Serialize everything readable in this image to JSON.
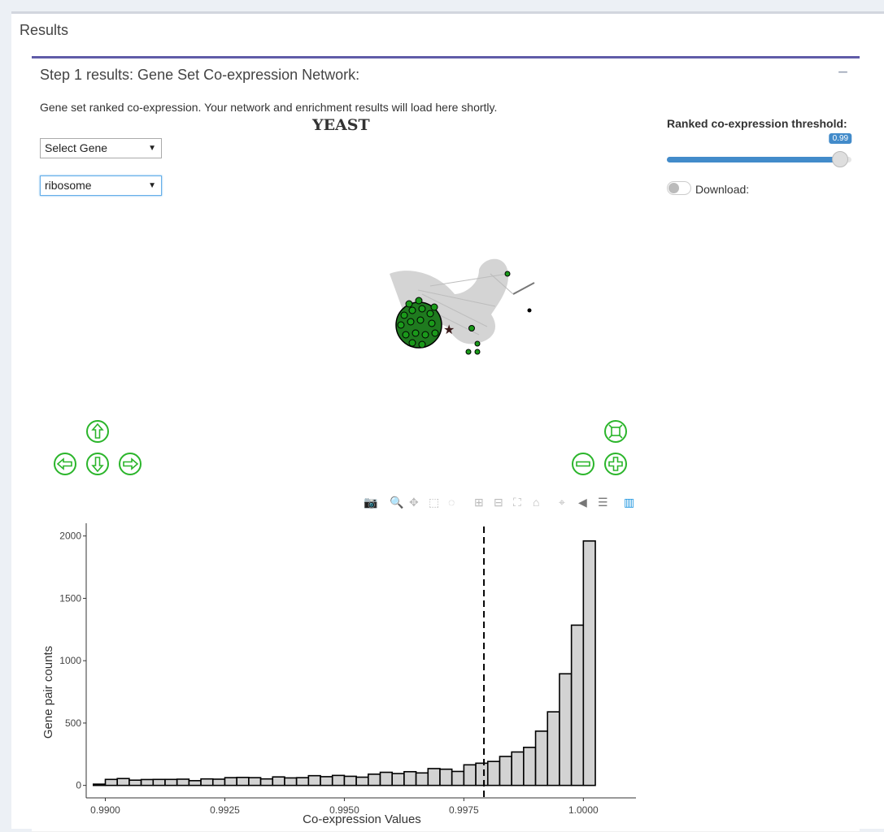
{
  "header": {
    "title": "Results"
  },
  "panel": {
    "title": "Step 1 results: Gene Set Co-expression Network:",
    "collapse_symbol": "−",
    "info": "Gene set ranked co-expression. Your network and enrichment results will load here shortly.",
    "network_title": "YEAST"
  },
  "controls": {
    "gene_select": "Select Gene",
    "set_select": "ribosome",
    "threshold_label": "Ranked co-expression threshold:",
    "threshold_value": "0.99",
    "threshold_fraction": 0.94,
    "download_label": "Download:"
  },
  "colors": {
    "nav_green": "#2bb52b",
    "slider_blue": "#428bca",
    "header_purple": "#605ca8"
  },
  "chart_data": {
    "type": "bar",
    "xlabel": "Co-expression Values",
    "ylabel": "Gene pair counts",
    "xlim": [
      0.9896,
      1.0011
    ],
    "ylim": [
      -100,
      2050
    ],
    "xticks": [
      "0.9900",
      "0.9925",
      "0.9950",
      "0.9975",
      "1.0000"
    ],
    "xtick_values": [
      0.99,
      0.9925,
      0.995,
      0.9975,
      1.0
    ],
    "yticks": [
      "0",
      "500",
      "1000",
      "1500",
      "2000"
    ],
    "ytick_values": [
      0,
      500,
      1000,
      1500,
      2000
    ],
    "bin_start": 0.98975,
    "bin_width": 0.00025,
    "values": [
      10,
      48,
      55,
      42,
      47,
      48,
      48,
      50,
      38,
      52,
      50,
      62,
      64,
      62,
      52,
      68,
      60,
      62,
      78,
      70,
      80,
      73,
      66,
      90,
      105,
      95,
      110,
      100,
      135,
      130,
      112,
      165,
      178,
      192,
      232,
      268,
      305,
      435,
      590,
      895,
      1285,
      1960
    ],
    "threshold_line": 0.99792
  }
}
